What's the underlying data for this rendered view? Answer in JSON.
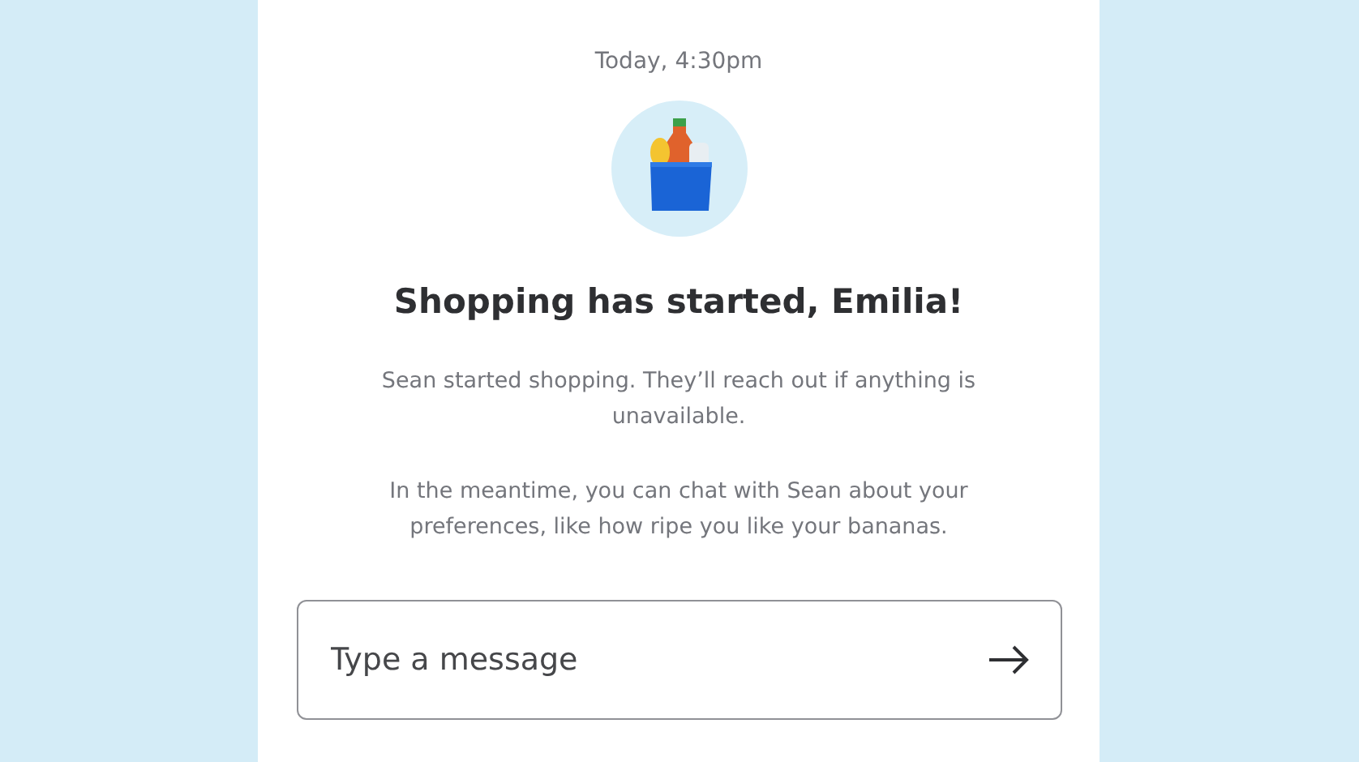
{
  "timestamp": "Today, 4:30pm",
  "heading": "Shopping has started, Emilia!",
  "paragraphs": [
    "Sean started shopping. They’ll reach out if anything is unavailable.",
    "In the meantime, you can chat with Sean about your preferences, like how ripe you like your bananas."
  ],
  "message_field": {
    "placeholder": "Type a message"
  }
}
